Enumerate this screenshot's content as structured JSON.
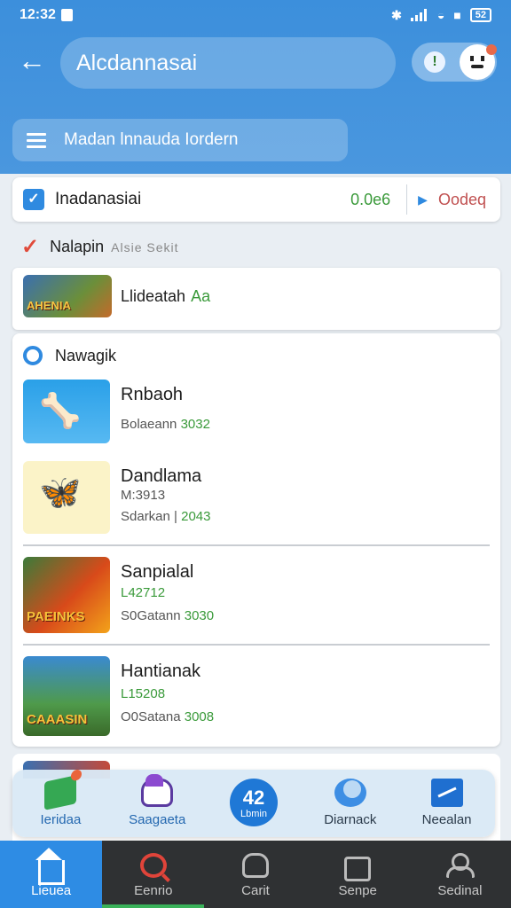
{
  "status_bar": {
    "time": "12:32",
    "battery": "52"
  },
  "header": {
    "title": "Alcdannasai",
    "sub_search_text": "Madan lnnauda Iordern"
  },
  "filter": {
    "label": "Inadanasiai",
    "value": "0.0e6",
    "sort_label": "Oodeq"
  },
  "section1": {
    "title": "Nalapin",
    "subtitle": "Alsie Sekit"
  },
  "featured": {
    "title": "Llideatah",
    "tag": "Aa",
    "thumb_text": "AHENIA"
  },
  "list": {
    "title": "Nawagik",
    "items": [
      {
        "title": "Rnbaoh",
        "line1_label": "Bolaeann",
        "line1_value": "3032",
        "line2": ""
      },
      {
        "title": "Dandlama",
        "line1_label": "M:3913",
        "line1_value": "",
        "line2_label": "Sdarkan |",
        "line2_value": "2043"
      },
      {
        "title": "Sanpialal",
        "line1_label": "",
        "line1_value": "L42712",
        "line2_label": "S0Gatann",
        "line2_value": "3030",
        "thumb_text": "PAEINKS"
      },
      {
        "title": "Hantianak",
        "line1_label": "",
        "line1_value": "L15208",
        "line2_label": "O0Satana",
        "line2_value": "3008",
        "thumb_text": "CAAASIN"
      }
    ]
  },
  "action_bar": [
    {
      "label": "Ieridaa",
      "icon": "money-icon"
    },
    {
      "label": "Saagaeta",
      "icon": "cloud-icon"
    },
    {
      "label": "Lbmin",
      "fab_text": "42",
      "icon": "fab"
    },
    {
      "label": "Diarnack",
      "icon": "moon-icon"
    },
    {
      "label": "Neealan",
      "icon": "flag-icon"
    }
  ],
  "bottom_nav": [
    {
      "label": "Lieuea",
      "icon": "home-icon"
    },
    {
      "label": "Eenrio",
      "icon": "search-icon"
    },
    {
      "label": "Carit",
      "icon": "lock-icon"
    },
    {
      "label": "Senpe",
      "icon": "box-icon"
    },
    {
      "label": "Sedinal",
      "icon": "user-icon"
    }
  ],
  "colors": {
    "header": "#3c8fdc",
    "accent_green": "#3a9a3a",
    "nav_active": "#2e8ce4",
    "nav_bg": "#2f3133"
  }
}
